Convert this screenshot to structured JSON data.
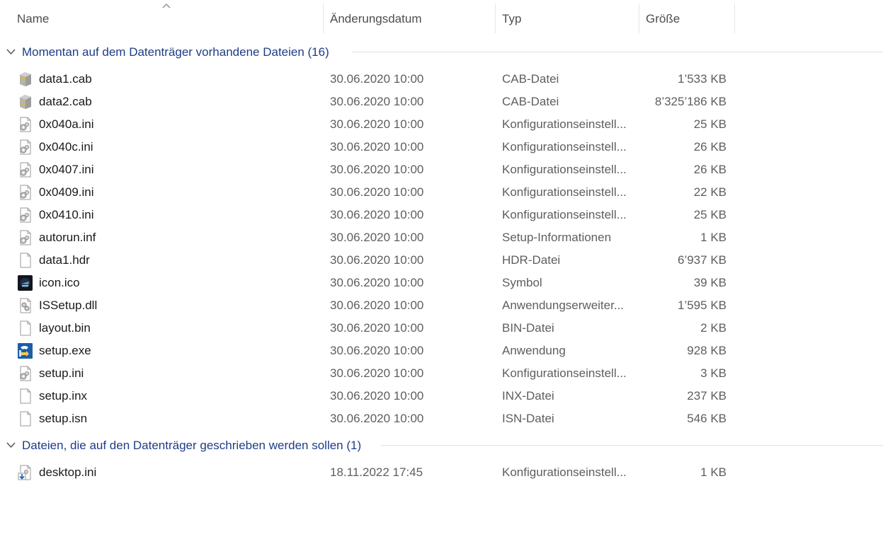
{
  "columns": {
    "name": "Name",
    "date": "Änderungsdatum",
    "type": "Typ",
    "size": "Größe"
  },
  "groups": [
    {
      "title": "Momentan auf dem Datenträger vorhandene Dateien (16)",
      "files": [
        {
          "name": "data1.cab",
          "date": "30.06.2020 10:00",
          "type": "CAB-Datei",
          "size": "1’533 KB",
          "icon": "cab-file-icon"
        },
        {
          "name": "data2.cab",
          "date": "30.06.2020 10:00",
          "type": "CAB-Datei",
          "size": "8’325’186 KB",
          "icon": "cab-file-icon"
        },
        {
          "name": "0x040a.ini",
          "date": "30.06.2020 10:00",
          "type": "Konfigurationseinstell...",
          "size": "25 KB",
          "icon": "config-file-icon"
        },
        {
          "name": "0x040c.ini",
          "date": "30.06.2020 10:00",
          "type": "Konfigurationseinstell...",
          "size": "26 KB",
          "icon": "config-file-icon"
        },
        {
          "name": "0x0407.ini",
          "date": "30.06.2020 10:00",
          "type": "Konfigurationseinstell...",
          "size": "26 KB",
          "icon": "config-file-icon"
        },
        {
          "name": "0x0409.ini",
          "date": "30.06.2020 10:00",
          "type": "Konfigurationseinstell...",
          "size": "22 KB",
          "icon": "config-file-icon"
        },
        {
          "name": "0x0410.ini",
          "date": "30.06.2020 10:00",
          "type": "Konfigurationseinstell...",
          "size": "25 KB",
          "icon": "config-file-icon"
        },
        {
          "name": "autorun.inf",
          "date": "30.06.2020 10:00",
          "type": "Setup-Informationen",
          "size": "1 KB",
          "icon": "config-file-icon"
        },
        {
          "name": "data1.hdr",
          "date": "30.06.2020 10:00",
          "type": "HDR-Datei",
          "size": "6’937 KB",
          "icon": "blank-file-icon"
        },
        {
          "name": "icon.ico",
          "date": "30.06.2020 10:00",
          "type": "Symbol",
          "size": "39 KB",
          "icon": "ico-file-icon"
        },
        {
          "name": "ISSetup.dll",
          "date": "30.06.2020 10:00",
          "type": "Anwendungserweiter...",
          "size": "1’595 KB",
          "icon": "dll-file-icon"
        },
        {
          "name": "layout.bin",
          "date": "30.06.2020 10:00",
          "type": "BIN-Datei",
          "size": "2 KB",
          "icon": "blank-file-icon"
        },
        {
          "name": "setup.exe",
          "date": "30.06.2020 10:00",
          "type": "Anwendung",
          "size": "928 KB",
          "icon": "setup-exe-icon"
        },
        {
          "name": "setup.ini",
          "date": "30.06.2020 10:00",
          "type": "Konfigurationseinstell...",
          "size": "3 KB",
          "icon": "config-file-icon"
        },
        {
          "name": "setup.inx",
          "date": "30.06.2020 10:00",
          "type": "INX-Datei",
          "size": "237 KB",
          "icon": "blank-file-icon"
        },
        {
          "name": "setup.isn",
          "date": "30.06.2020 10:00",
          "type": "ISN-Datei",
          "size": "546 KB",
          "icon": "blank-file-icon"
        }
      ]
    },
    {
      "title": "Dateien, die auf den Datenträger geschrieben werden sollen (1)",
      "files": [
        {
          "name": "desktop.ini",
          "date": "18.11.2022 17:45",
          "type": "Konfigurationseinstell...",
          "size": "1 KB",
          "icon": "pending-burn-file-icon"
        }
      ]
    }
  ],
  "colors": {
    "group_title": "#1e3d87",
    "secondary_text": "#5e5e5e",
    "header_text": "#4d4d4d"
  }
}
